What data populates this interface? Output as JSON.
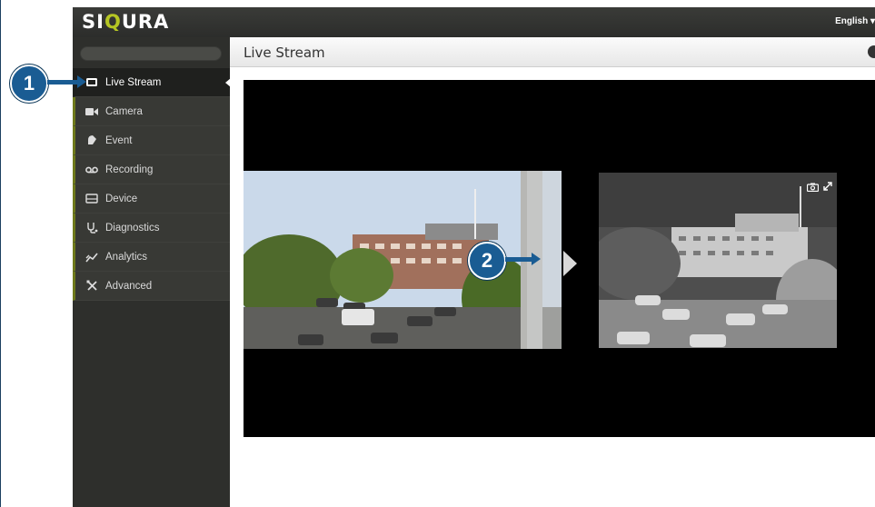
{
  "app": {
    "logo_text_pre": "SI",
    "logo_text_hl": "Q",
    "logo_text_post": "URA",
    "language": "English ▾"
  },
  "colors": {
    "accent_green": "#b5c623",
    "callout_blue": "#1a5c93",
    "sidebar_bg": "#2e2f2c"
  },
  "sidebar": {
    "search_placeholder": "",
    "items": [
      {
        "label": "Live Stream",
        "icon": "video-screen-icon",
        "active": true
      },
      {
        "label": "Camera",
        "icon": "video-camera-icon"
      },
      {
        "label": "Event",
        "icon": "event-bell-icon"
      },
      {
        "label": "Recording",
        "icon": "recording-tape-icon"
      },
      {
        "label": "Device",
        "icon": "device-box-icon"
      },
      {
        "label": "Diagnostics",
        "icon": "stethoscope-icon"
      },
      {
        "label": "Analytics",
        "icon": "analytics-graph-icon"
      },
      {
        "label": "Advanced",
        "icon": "tools-icon"
      }
    ]
  },
  "header": {
    "title": "Live Stream"
  },
  "callouts": {
    "one": "1",
    "two": "2"
  }
}
